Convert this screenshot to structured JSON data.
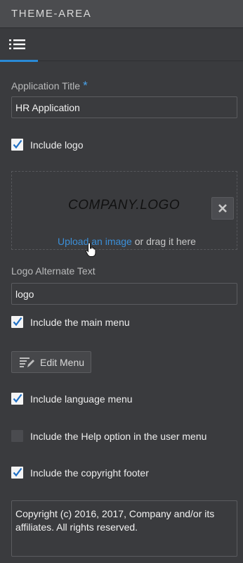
{
  "header": {
    "title": "THEME-AREA"
  },
  "tabs": [
    {
      "icon": "list-icon",
      "active": true
    }
  ],
  "app_title": {
    "label": "Application Title",
    "required_mark": "*",
    "value": "HR Application"
  },
  "include_logo": {
    "label": "Include logo",
    "checked": true
  },
  "logo_dropzone": {
    "preview_text": "COMPANY.LOGO",
    "upload_link": "Upload an image",
    "upload_rest": " or drag it here",
    "remove_icon": "close-icon"
  },
  "logo_alt": {
    "label": "Logo Alternate Text",
    "value": "logo"
  },
  "include_main_menu": {
    "label": "Include the main menu",
    "checked": true
  },
  "edit_menu": {
    "label": "Edit Menu",
    "icon": "edit-menu-icon"
  },
  "include_language_menu": {
    "label": "Include language menu",
    "checked": true
  },
  "include_help": {
    "label": "Include the Help option in the user menu",
    "checked": false
  },
  "include_copyright": {
    "label": "Include the copyright footer",
    "checked": true
  },
  "copyright_text": "Copyright (c) 2016, 2017, Company and/or its affiliates. All rights reserved.",
  "colors": {
    "accent": "#2a8ad6",
    "link": "#3b8fd8",
    "background": "#3a3b3e",
    "header": "#4b4c4f"
  }
}
